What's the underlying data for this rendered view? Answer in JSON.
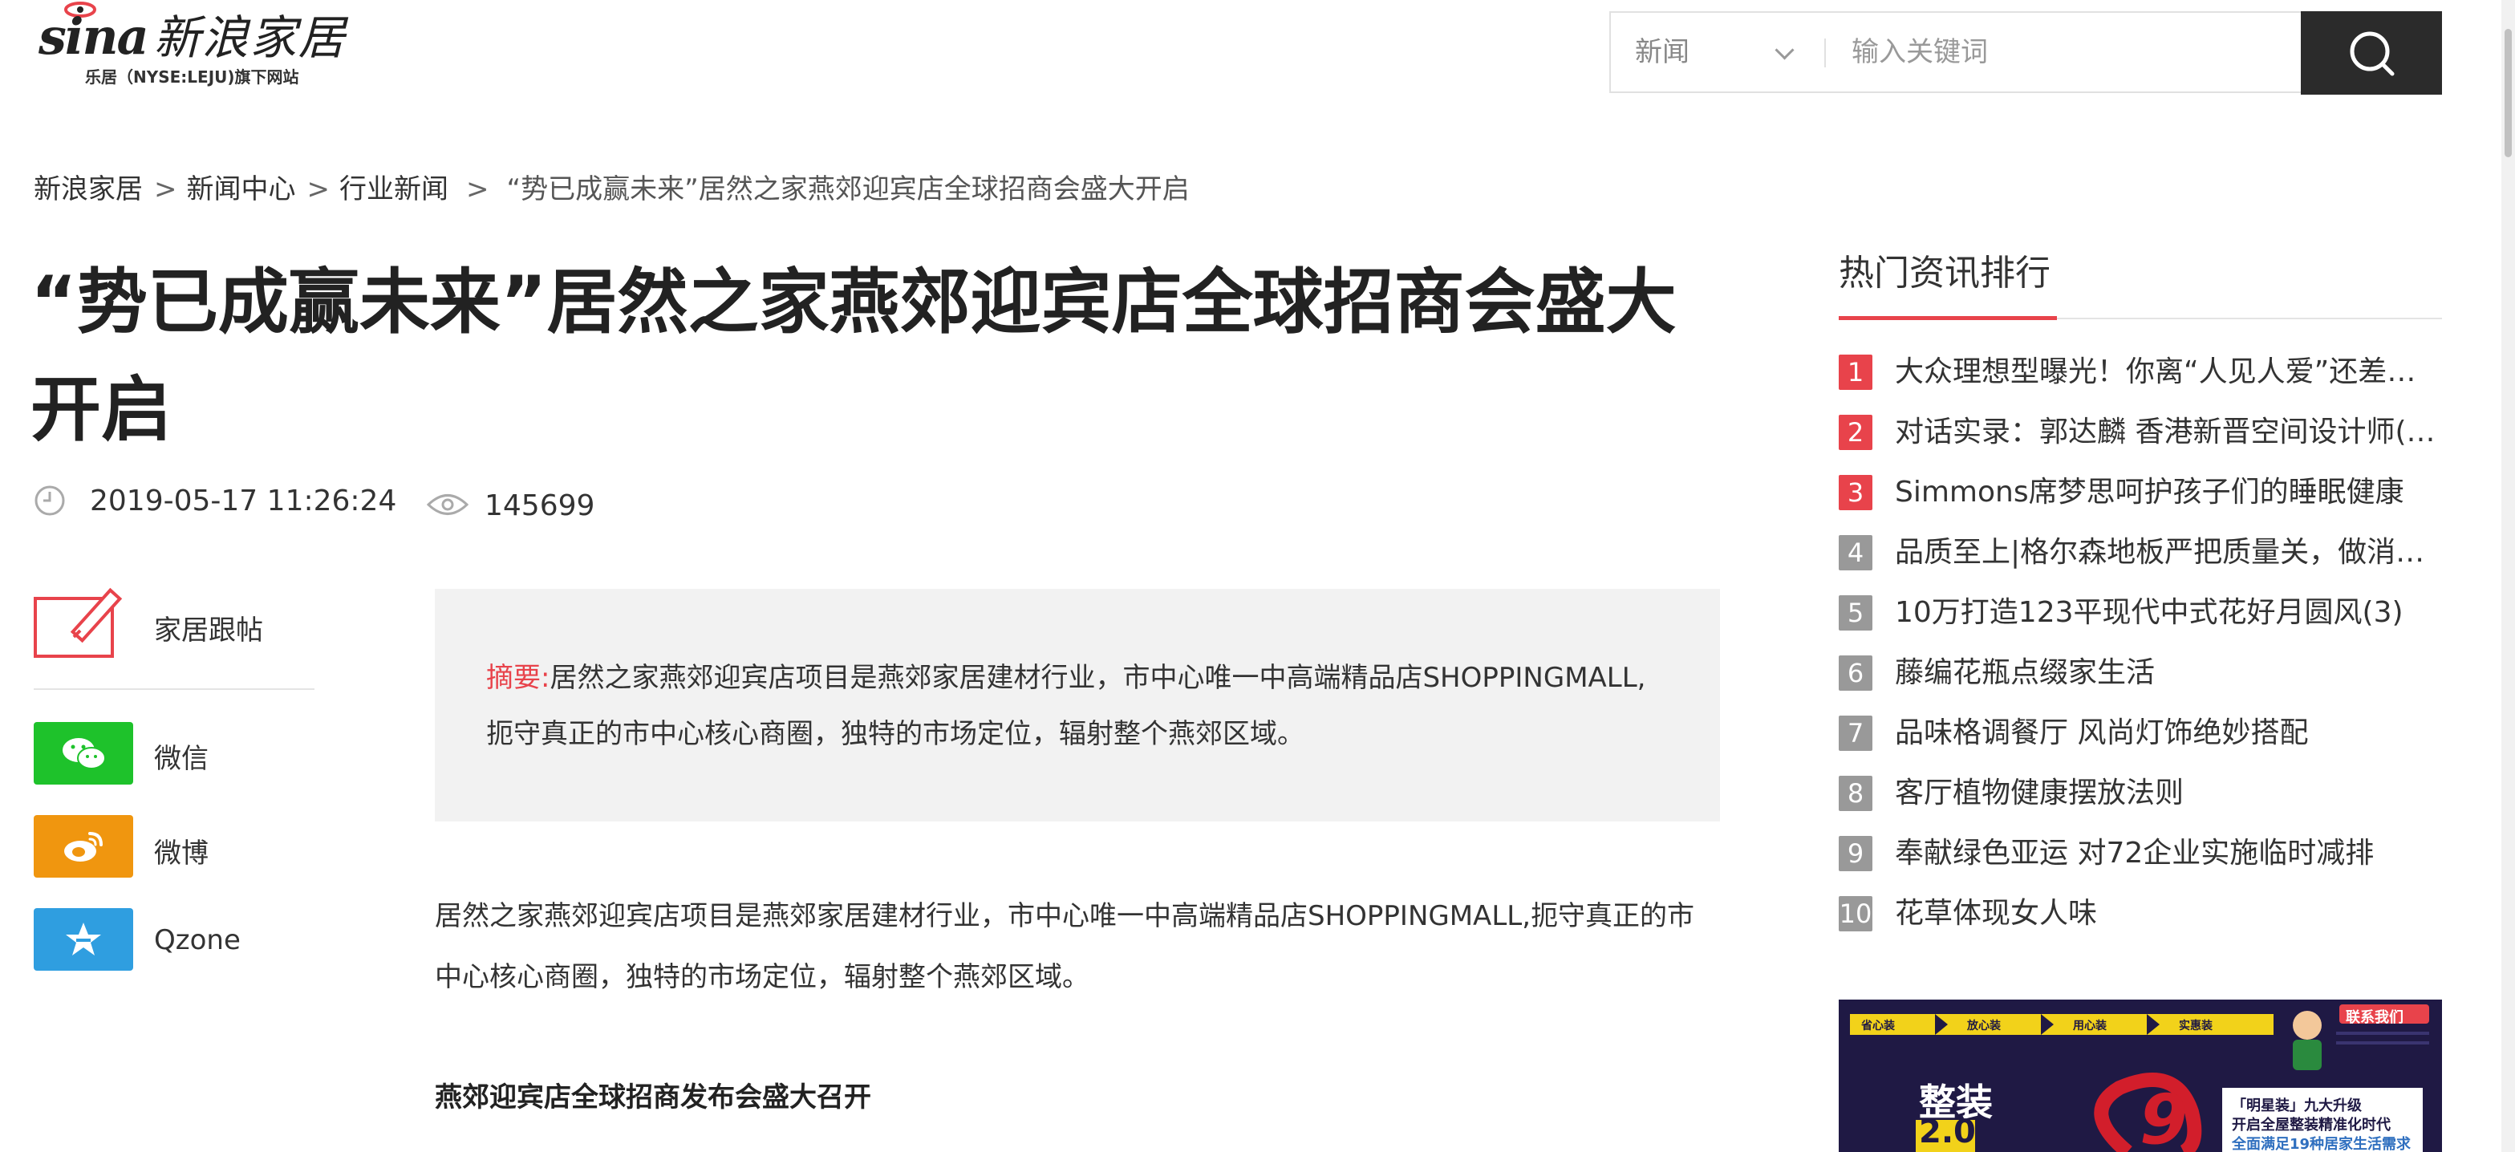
{
  "logo": {
    "brand": "sina",
    "name": "新浪家居",
    "tagline": "乐居（NYSE:LEJU)旗下网站"
  },
  "search": {
    "category": "新闻",
    "placeholder": "输入关键词"
  },
  "breadcrumb": {
    "items": [
      "新浪家居",
      "新闻中心",
      "行业新闻"
    ],
    "separator": ">",
    "current": "“势已成赢未来”居然之家燕郊迎宾店全球招商会盛大开启"
  },
  "article": {
    "title": "“势已成赢未来”居然之家燕郊迎宾店全球招商会盛大开启",
    "datetime": "2019-05-17 11:26:24",
    "views": "145699",
    "summary_label": "摘要:",
    "summary_text": "居然之家燕郊迎宾店项目是燕郊家居建材行业，市中心唯一中高端精品店SHOPPINGMALL,扼守真正的市中心核心商圈，独特的市场定位，辐射整个燕郊区域。",
    "paragraph": "居然之家燕郊迎宾店项目是燕郊家居建材行业，市中心唯一中高端精品店SHOPPINGMALL,扼守真正的市中心核心商圈，独特的市场定位，辐射整个燕郊区域。",
    "subheading": "燕郊迎宾店全球招商发布会盛大召开"
  },
  "share": {
    "follow_label": "家居跟帖",
    "wechat_label": "微信",
    "weibo_label": "微博",
    "qzone_label": "Qzone"
  },
  "colors": {
    "accent_red": "#e8434b",
    "rank_gray": "#999999",
    "wechat_green": "#1ec22b",
    "weibo_orange": "#f0960f",
    "qzone_blue": "#2f9ee0",
    "search_button": "#2b2b2b"
  },
  "ranking": {
    "title": "热门资讯排行",
    "items": [
      {
        "num": "1",
        "text": "大众理想型曝光！你离“人见人爱”还差一步"
      },
      {
        "num": "2",
        "text": "对话实录：郭达麟 香港新晋空间设计师(图)"
      },
      {
        "num": "3",
        "text": "Simmons席梦思呵护孩子们的睡眠健康"
      },
      {
        "num": "4",
        "text": "品质至上|格尔森地板严把质量关，做消费者放心品牌"
      },
      {
        "num": "5",
        "text": "10万打造123平现代中式花好月圆风(3)"
      },
      {
        "num": "6",
        "text": "藤编花瓶点缀家生活"
      },
      {
        "num": "7",
        "text": "品味格调餐厅 风尚灯饰绝妙搭配"
      },
      {
        "num": "8",
        "text": "客厅植物健康摆放法则"
      },
      {
        "num": "9",
        "text": "奉献绿色亚运 对72企业实施临时减排"
      },
      {
        "num": "10",
        "text": "花草体现女人味"
      }
    ]
  },
  "ad": {
    "steps": [
      "省心装",
      "放心装",
      "用心装",
      "实惠装"
    ],
    "contact": "联系我们",
    "headline": "整装",
    "version": "2.0",
    "slogan_1": "「明星装」九大升级",
    "slogan_2": "开启全屋整装精准化时代",
    "slogan_3": "全面满足19种居家生活需求",
    "big_number": "9"
  }
}
